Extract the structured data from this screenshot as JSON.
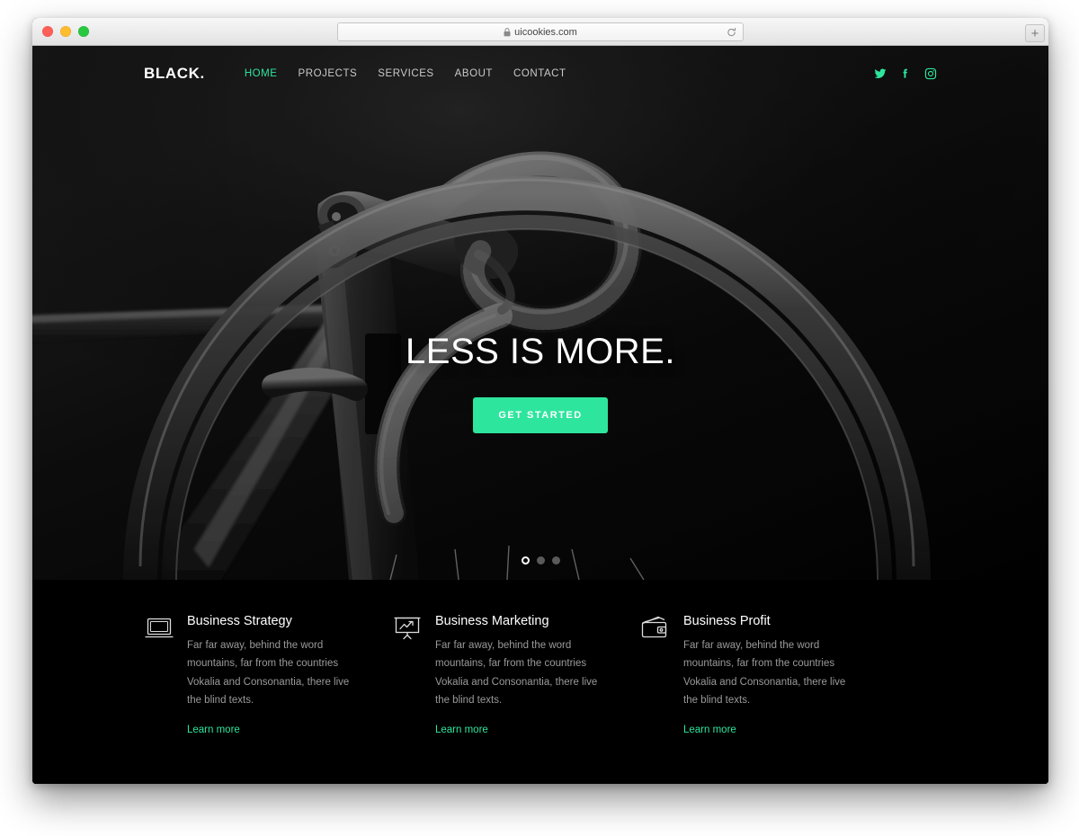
{
  "browser": {
    "url": "uicookies.com",
    "lock_icon": "lock-icon",
    "reload_icon": "reload-icon",
    "newtab_label": "+",
    "traffic_lights": [
      "close-red",
      "minimize-yellow",
      "maximize-green"
    ]
  },
  "site": {
    "logo": "BLACK.",
    "nav": [
      {
        "label": "HOME",
        "active": true
      },
      {
        "label": "PROJECTS",
        "active": false
      },
      {
        "label": "SERVICES",
        "active": false
      },
      {
        "label": "ABOUT",
        "active": false
      },
      {
        "label": "CONTACT",
        "active": false
      }
    ],
    "socials": [
      {
        "name": "twitter-icon"
      },
      {
        "name": "facebook-icon"
      },
      {
        "name": "instagram-icon"
      }
    ],
    "hero": {
      "title": "LESS IS MORE.",
      "cta": "GET STARTED",
      "slides": 3,
      "active_slide": 1,
      "background": "black-and-white bicycle handlebar photograph"
    },
    "features": [
      {
        "icon": "laptop-icon",
        "title": "Business Strategy",
        "text": "Far far away, behind the word mountains, far from the countries Vokalia and Consonantia, there live the blind texts.",
        "link": "Learn more"
      },
      {
        "icon": "presentation-chart-icon",
        "title": "Business Marketing",
        "text": "Far far away, behind the word mountains, far from the countries Vokalia and Consonantia, there live the blind texts.",
        "link": "Learn more"
      },
      {
        "icon": "wallet-icon",
        "title": "Business Profit",
        "text": "Far far away, behind the word mountains, far from the countries Vokalia and Consonantia, there live the blind texts.",
        "link": "Learn more"
      }
    ]
  },
  "colors": {
    "accent": "#2ee59d",
    "background": "#000000",
    "text_muted": "#9a9a9a",
    "text_light": "#ffffff"
  }
}
